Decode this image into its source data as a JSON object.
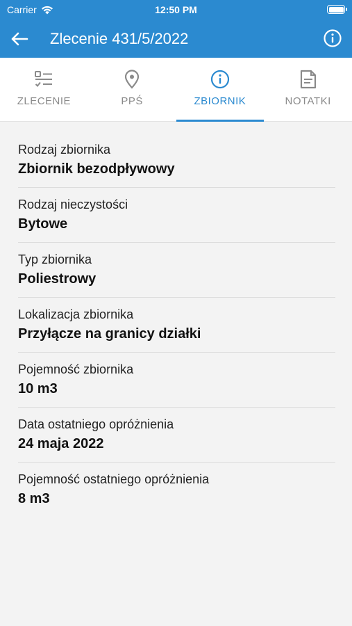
{
  "status_bar": {
    "carrier": "Carrier",
    "time": "12:50 PM"
  },
  "header": {
    "title": "Zlecenie 431/5/2022",
    "back_icon": "arrow-left-icon",
    "info_icon": "info-circle-icon",
    "color": "#2b8ad0"
  },
  "tabs": [
    {
      "label": "ZLECENIE",
      "icon": "checklist-icon",
      "active": false
    },
    {
      "label": "PPŚ",
      "icon": "location-pin-icon",
      "active": false
    },
    {
      "label": "ZBIORNIK",
      "icon": "info-circle-icon",
      "active": true
    },
    {
      "label": "NOTATKI",
      "icon": "note-icon",
      "active": false
    }
  ],
  "fields": [
    {
      "label": "Rodzaj zbiornika",
      "value": "Zbiornik bezodpływowy"
    },
    {
      "label": "Rodzaj nieczystości",
      "value": "Bytowe"
    },
    {
      "label": "Typ zbiornika",
      "value": "Poliestrowy"
    },
    {
      "label": "Lokalizacja zbiornika",
      "value": "Przyłącze na granicy działki"
    },
    {
      "label": "Pojemność zbiornika",
      "value": "10 m3"
    },
    {
      "label": "Data ostatniego opróżnienia",
      "value": "24 maja 2022"
    },
    {
      "label": "Pojemność ostatniego opróżnienia",
      "value": "8 m3"
    }
  ]
}
